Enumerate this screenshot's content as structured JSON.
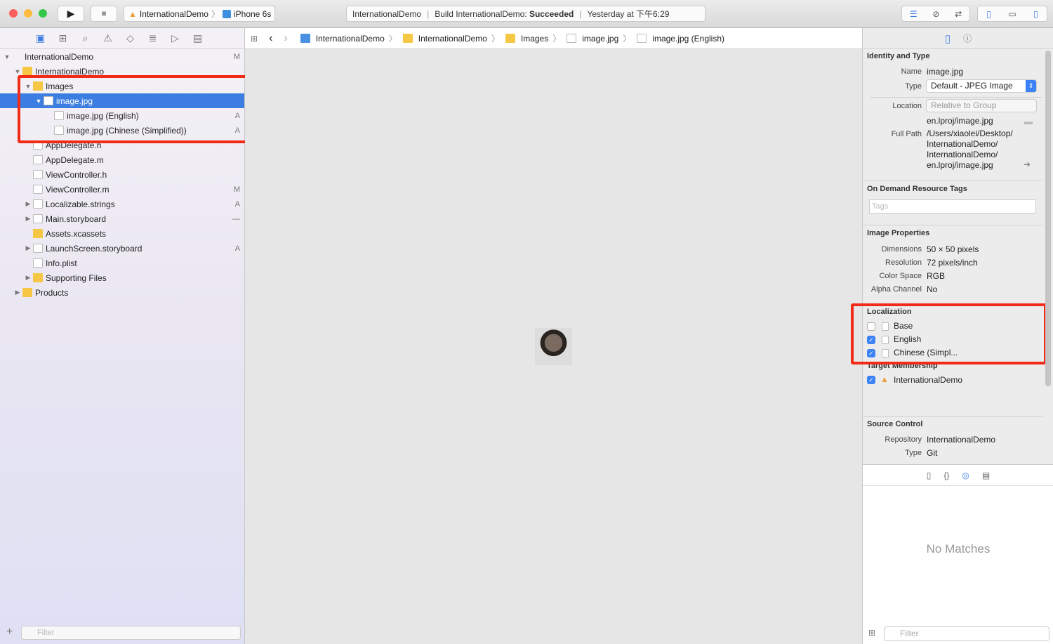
{
  "toolbar": {
    "scheme": "InternationalDemo",
    "device": "iPhone 6s",
    "activity_project": "InternationalDemo",
    "activity_build": "Build InternationalDemo:",
    "activity_status": "Succeeded",
    "activity_time": "Yesterday at 下午6:29"
  },
  "navigator": {
    "tree": [
      {
        "label": "InternationalDemo",
        "level": 0,
        "icon": "project",
        "disclosure": "open",
        "badge": "M"
      },
      {
        "label": "InternationalDemo",
        "level": 1,
        "icon": "folder",
        "disclosure": "open",
        "badge": ""
      },
      {
        "label": "Images",
        "level": 2,
        "icon": "folder",
        "disclosure": "open",
        "badge": ""
      },
      {
        "label": "image.jpg",
        "level": 3,
        "icon": "file",
        "disclosure": "open",
        "badge": "",
        "selected": true
      },
      {
        "label": "image.jpg (English)",
        "level": 4,
        "icon": "file",
        "disclosure": "",
        "badge": "A"
      },
      {
        "label": "image.jpg (Chinese (Simplified))",
        "level": 4,
        "icon": "file",
        "disclosure": "",
        "badge": "A"
      },
      {
        "label": "AppDelegate.h",
        "level": 2,
        "icon": "file",
        "disclosure": "",
        "badge": ""
      },
      {
        "label": "AppDelegate.m",
        "level": 2,
        "icon": "file",
        "disclosure": "",
        "badge": ""
      },
      {
        "label": "ViewController.h",
        "level": 2,
        "icon": "file",
        "disclosure": "",
        "badge": ""
      },
      {
        "label": "ViewController.m",
        "level": 2,
        "icon": "file",
        "disclosure": "",
        "badge": "M"
      },
      {
        "label": "Localizable.strings",
        "level": 2,
        "icon": "file",
        "disclosure": "closed",
        "badge": "A"
      },
      {
        "label": "Main.storyboard",
        "level": 2,
        "icon": "file",
        "disclosure": "closed",
        "badge": "—"
      },
      {
        "label": "Assets.xcassets",
        "level": 2,
        "icon": "folder",
        "disclosure": "",
        "badge": ""
      },
      {
        "label": "LaunchScreen.storyboard",
        "level": 2,
        "icon": "file",
        "disclosure": "closed",
        "badge": "A"
      },
      {
        "label": "Info.plist",
        "level": 2,
        "icon": "file",
        "disclosure": "",
        "badge": ""
      },
      {
        "label": "Supporting Files",
        "level": 2,
        "icon": "folder",
        "disclosure": "closed",
        "badge": ""
      },
      {
        "label": "Products",
        "level": 1,
        "icon": "folder",
        "disclosure": "closed",
        "badge": ""
      }
    ],
    "filter_placeholder": "Filter"
  },
  "jumpbar": [
    "InternationalDemo",
    "InternationalDemo",
    "Images",
    "image.jpg",
    "image.jpg (English)"
  ],
  "inspector": {
    "identity": {
      "title": "Identity and Type",
      "name_label": "Name",
      "name": "image.jpg",
      "type_label": "Type",
      "type": "Default - JPEG Image",
      "location_label": "Location",
      "location": "Relative to Group",
      "rel_path": "en.lproj/image.jpg",
      "fullpath_label": "Full Path",
      "fullpath": [
        "/Users/xiaolei/Desktop/",
        "InternationalDemo/",
        "InternationalDemo/",
        "en.lproj/image.jpg"
      ]
    },
    "tags": {
      "title": "On Demand Resource Tags",
      "placeholder": "Tags"
    },
    "image": {
      "title": "Image Properties",
      "rows": [
        {
          "label": "Dimensions",
          "value": "50 × 50 pixels"
        },
        {
          "label": "Resolution",
          "value": "72 pixels/inch"
        },
        {
          "label": "Color Space",
          "value": "RGB"
        },
        {
          "label": "Alpha Channel",
          "value": "No"
        }
      ]
    },
    "localization": {
      "title": "Localization",
      "items": [
        {
          "label": "Base",
          "checked": false
        },
        {
          "label": "English",
          "checked": true
        },
        {
          "label": "Chinese (Simpl...",
          "checked": true
        }
      ]
    },
    "target": {
      "title": "Target Membership",
      "items": [
        {
          "label": "InternationalDemo",
          "checked": true
        }
      ]
    },
    "source": {
      "title": "Source Control",
      "repo_label": "Repository",
      "repo": "InternationalDemo",
      "type_label": "Type",
      "type": "Git"
    },
    "library": {
      "empty": "No Matches",
      "filter_placeholder": "Filter"
    }
  }
}
